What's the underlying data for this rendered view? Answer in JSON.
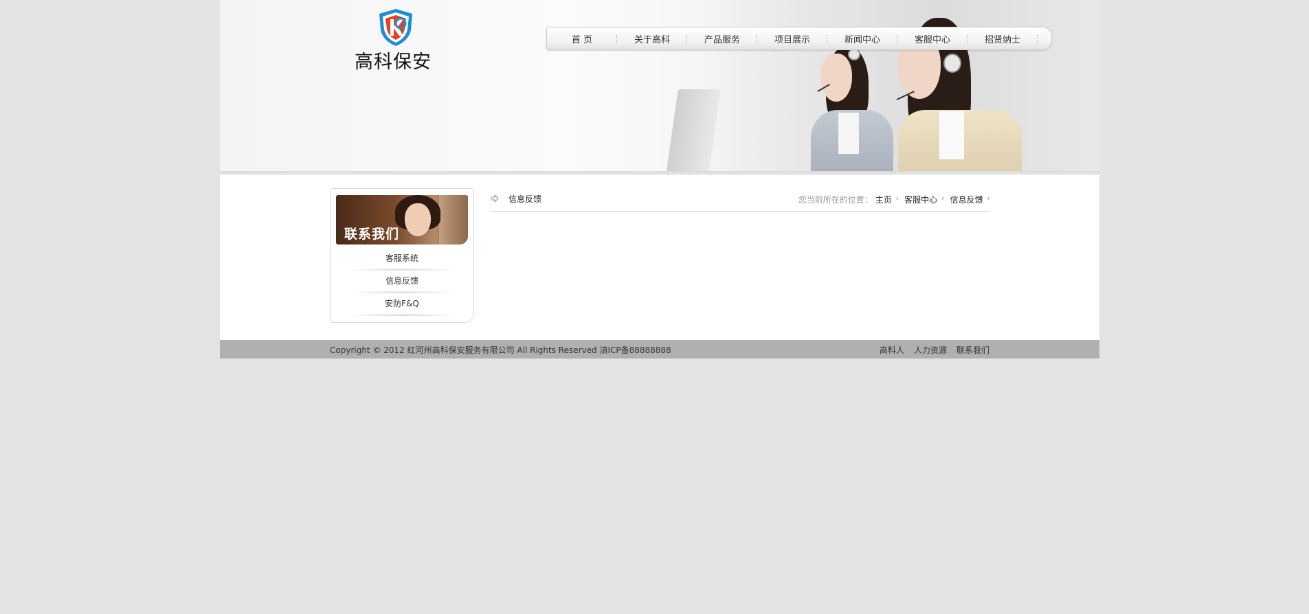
{
  "header": {
    "logo_text": "高科保安",
    "nav": [
      "首 页",
      "关于高科",
      "产品服务",
      "项目展示",
      "新闻中心",
      "客服中心",
      "招贤纳士"
    ]
  },
  "sidebar": {
    "banner_title": "联系我们",
    "items": [
      "客服系统",
      "信息反馈",
      "安防F&Q"
    ]
  },
  "main": {
    "title": "信息反馈",
    "breadcrumb_label": "您当前所在的位置：",
    "breadcrumb": [
      "主页",
      "客服中心",
      "信息反馈"
    ]
  },
  "footer": {
    "copyright": "Copyright © 2012 红河州高科保安服务有限公司 All Rights Reserved 滇ICP备88888888",
    "links": [
      "高科人",
      "人力资源",
      "联系我们"
    ]
  },
  "colors": {
    "page_bg": "#e3e3e3",
    "footer_bg": "#b0b0b0",
    "logo_shield_outer": "#1a8fd6",
    "logo_shield_inner": "#e8401c"
  }
}
